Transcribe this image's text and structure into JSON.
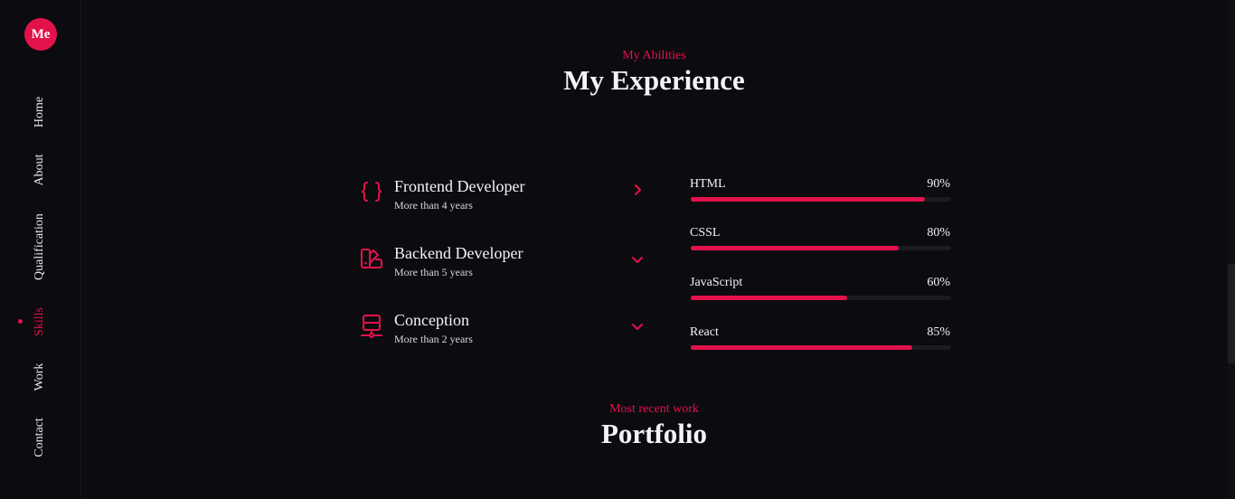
{
  "brand": {
    "logo_text": "Me",
    "accent": "#e3124b"
  },
  "nav": {
    "items": [
      {
        "label": "Home",
        "active": false
      },
      {
        "label": "About",
        "active": false
      },
      {
        "label": "Qualification",
        "active": false
      },
      {
        "label": "Skills",
        "active": true
      },
      {
        "label": "Work",
        "active": false
      },
      {
        "label": "Contact",
        "active": false
      }
    ]
  },
  "experience": {
    "subtitle": "My Abilities",
    "title": "My Experience",
    "qualifications": [
      {
        "title": "Frontend Developer",
        "subtitle": "More than 4 years",
        "icon": "braces-icon",
        "arrow": "chevron-right-icon"
      },
      {
        "title": "Backend Developer",
        "subtitle": "More than 5 years",
        "icon": "swatchbook-icon",
        "arrow": "chevron-down-icon"
      },
      {
        "title": "Conception",
        "subtitle": "More than 2 years",
        "icon": "server-icon",
        "arrow": "chevron-down-icon"
      }
    ],
    "skills": [
      {
        "name": "HTML",
        "percent_label": "90%",
        "percent": 90
      },
      {
        "name": "CSSL",
        "percent_label": "80%",
        "percent": 80
      },
      {
        "name": "JavaScript",
        "percent_label": "60%",
        "percent": 60
      },
      {
        "name": "React",
        "percent_label": "85%",
        "percent": 85
      }
    ]
  },
  "portfolio": {
    "subtitle": "Most recent work",
    "title": "Portfolio"
  }
}
